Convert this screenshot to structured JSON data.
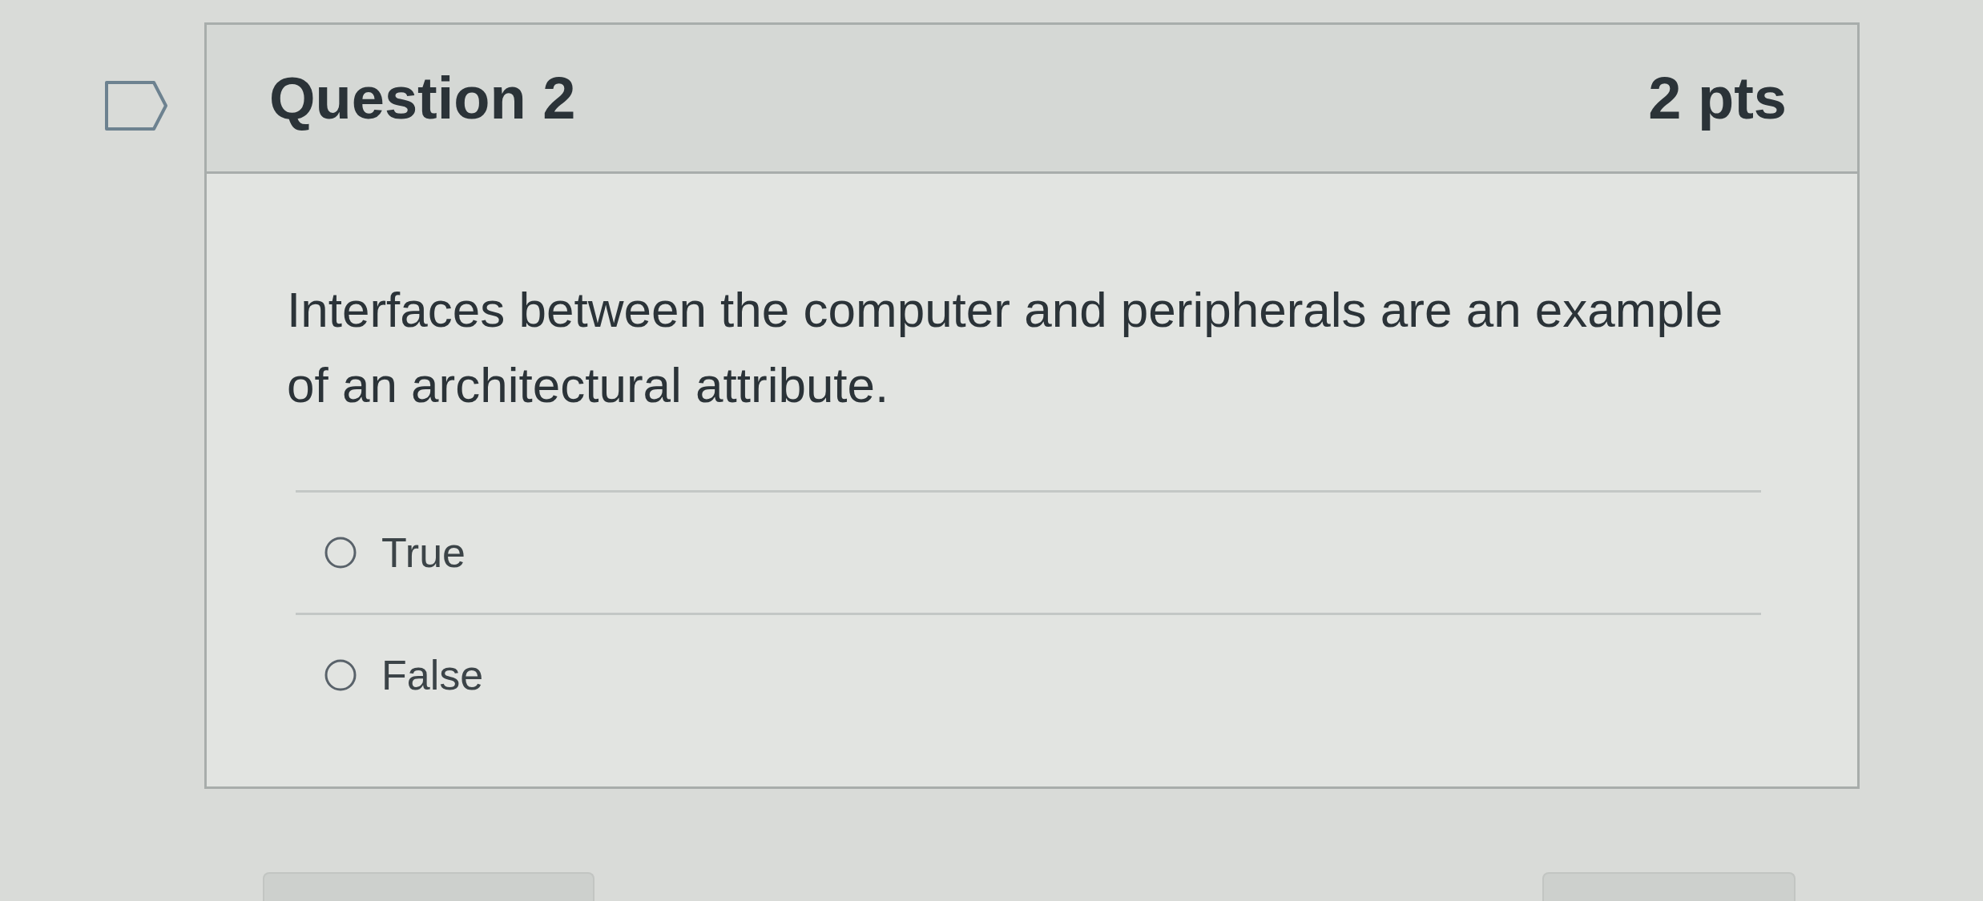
{
  "question": {
    "flagged": false,
    "title": "Question 2",
    "points": "2 pts"
  },
  "prompt": "Interfaces between the computer and peripherals are an example of an architectural attribute.",
  "answers": [
    {
      "label": "True",
      "selected": false
    },
    {
      "label": "False",
      "selected": false
    }
  ]
}
